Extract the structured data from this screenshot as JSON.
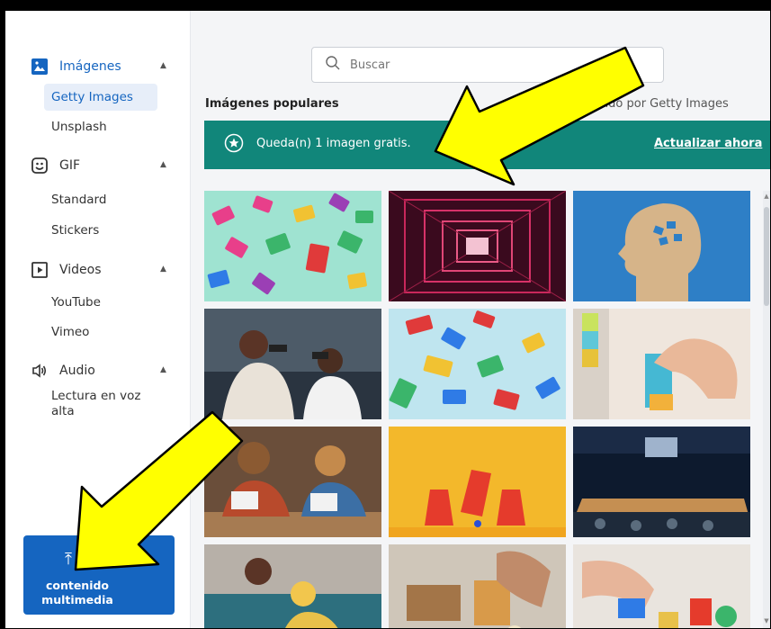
{
  "sidebar": {
    "sections": [
      {
        "label": "Imágenes",
        "icon": "image-icon",
        "active": true,
        "items": [
          "Getty Images",
          "Unsplash"
        ],
        "selected": "Getty Images"
      },
      {
        "label": "GIF",
        "icon": "gif-icon",
        "items": [
          "Standard",
          "Stickers"
        ]
      },
      {
        "label": "Videos",
        "icon": "video-icon",
        "items": [
          "YouTube",
          "Vimeo"
        ]
      },
      {
        "label": "Audio",
        "icon": "speaker-icon",
        "items": [
          "Lectura en voz alta"
        ]
      }
    ],
    "upload_label_line1": "contenido",
    "upload_label_line2": "multimedia"
  },
  "search": {
    "placeholder": "Buscar"
  },
  "main": {
    "section_title": "Imágenes populares",
    "credit": "onado por Getty Images",
    "banner_text": "Queda(n) 1 imagen gratis.",
    "banner_action": "Actualizar ahora"
  },
  "colors": {
    "accent": "#1565c0",
    "banner": "#11867a",
    "arrow": "#ffff00"
  }
}
